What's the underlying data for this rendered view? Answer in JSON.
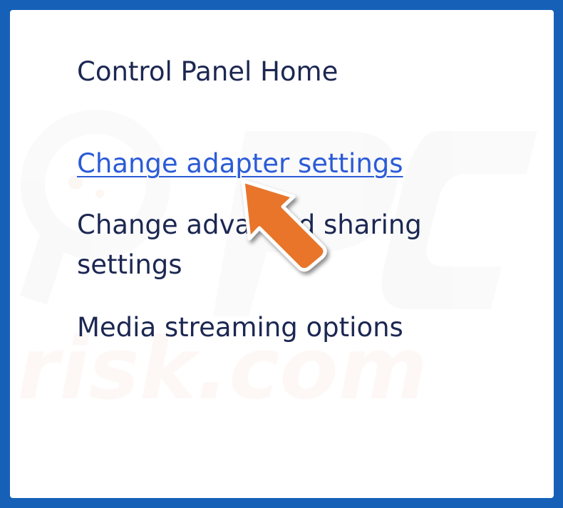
{
  "sidebar": {
    "items": [
      {
        "label": "Control Panel Home",
        "state": "normal"
      },
      {
        "label": "Change adapter settings",
        "state": "link-hover"
      },
      {
        "label": "Change advanced sharing settings",
        "state": "normal"
      },
      {
        "label": "Media streaming options",
        "state": "normal"
      }
    ]
  },
  "annotation": {
    "icon": "arrow-pointer-icon",
    "color": "#e8742a",
    "target": "Change adapter settings"
  },
  "colors": {
    "frame": "#1660b8",
    "background": "#ffffff",
    "text": "#1c2752",
    "link": "#2b5bd7"
  }
}
